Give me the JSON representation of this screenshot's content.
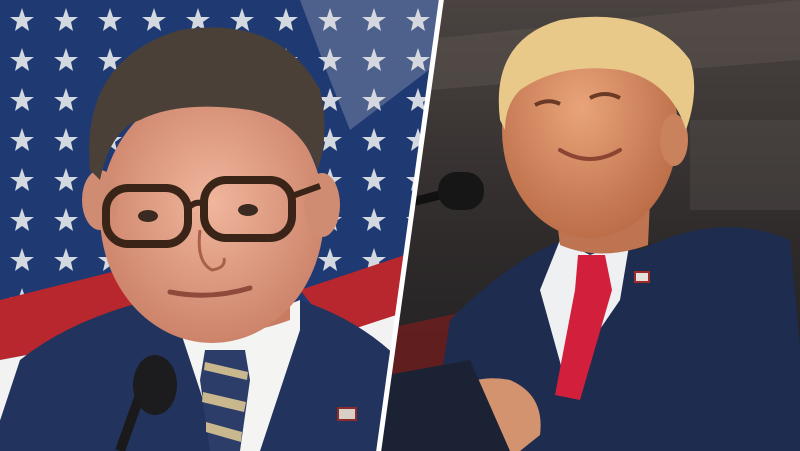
{
  "image": {
    "layout": "split-composite",
    "panels": [
      {
        "id": "left",
        "subject": "man-with-glasses",
        "background": "american-flag",
        "attire": [
          "navy-suit",
          "white-shirt",
          "navy-striped-tie",
          "flag-lapel-pin"
        ],
        "foreground": "microphone"
      },
      {
        "id": "right",
        "subject": "man-at-podium",
        "background": "dark-venue",
        "attire": [
          "navy-suit",
          "white-shirt",
          "red-tie",
          "flag-lapel-pin"
        ],
        "foreground": [
          "microphone",
          "podium"
        ]
      }
    ],
    "divider": "diagonal-white-line",
    "colors": {
      "flag_blue": "#1f3a73",
      "flag_red": "#b8262e",
      "flag_white": "#f2f2f2",
      "suit_navy": "#1e2c4f",
      "tie_red": "#d21f3c",
      "venue_dark": "#3a3433",
      "divider": "#ffffff"
    }
  }
}
